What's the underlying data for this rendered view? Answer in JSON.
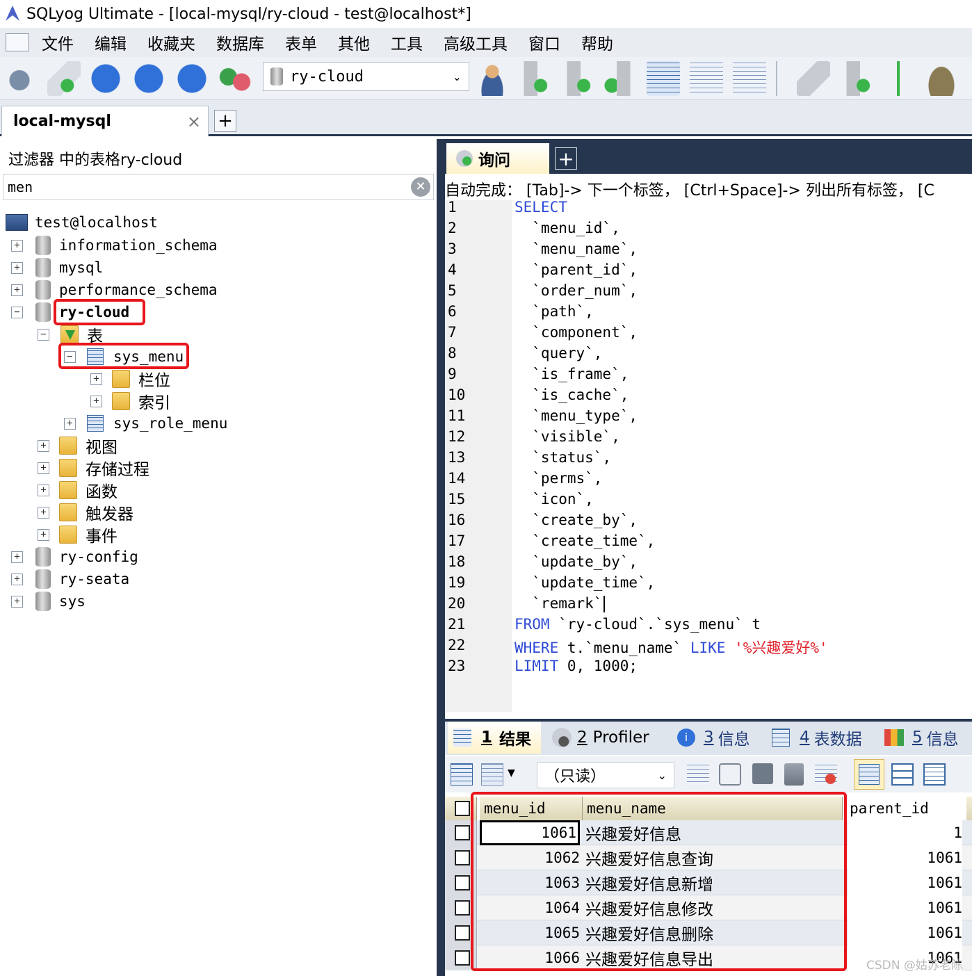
{
  "window": {
    "title": "SQLyog Ultimate - [local-mysql/ry-cloud - test@localhost*]"
  },
  "menu": [
    {
      "label": "文件",
      "underline": "件"
    },
    {
      "label": "编辑"
    },
    {
      "label": "收藏夹"
    },
    {
      "label": "数据库"
    },
    {
      "label": "表单"
    },
    {
      "label": "其他"
    },
    {
      "label": "工具"
    },
    {
      "label": "高级工具"
    },
    {
      "label": "窗口"
    },
    {
      "label": "帮助"
    }
  ],
  "toolbar": {
    "database_selector": "ry-cloud"
  },
  "connection_tab": {
    "label": "local-mysql",
    "close": "×",
    "add": "+"
  },
  "object_browser": {
    "filter_label": "过滤器 中的表格ry-cloud",
    "filter_value": "men",
    "host": "test@localhost",
    "databases": [
      "information_schema",
      "mysql",
      "performance_schema",
      "ry-cloud"
    ],
    "tables_folder": "表",
    "table_selected": "sys_menu",
    "columns_folder": "栏位",
    "indexes_folder": "索引",
    "table_other": "sys_role_menu",
    "folders": [
      "视图",
      "存储过程",
      "函数",
      "触发器",
      "事件"
    ],
    "other_databases": [
      "ry-config",
      "ry-seata",
      "sys"
    ],
    "expand": "+",
    "collapse": "−"
  },
  "query_tab": {
    "label": "询问",
    "add": "+"
  },
  "autocomplete_hint": "自动完成： [Tab]-> 下一个标签， [Ctrl+Space]-> 列出所有标签， [C",
  "editor": {
    "line_numbers": [
      "1",
      "2",
      "3",
      "4",
      "5",
      "6",
      "7",
      "8",
      "9",
      "10",
      "11",
      "12",
      "13",
      "14",
      "15",
      "16",
      "17",
      "18",
      "19",
      "20",
      "21",
      "22",
      "23"
    ],
    "lines": [
      {
        "kw": "SELECT",
        "text": "",
        "str": ""
      },
      {
        "kw": "",
        "text": "  `menu_id`,",
        "str": ""
      },
      {
        "kw": "",
        "text": "  `menu_name`,",
        "str": ""
      },
      {
        "kw": "",
        "text": "  `parent_id`,",
        "str": ""
      },
      {
        "kw": "",
        "text": "  `order_num`,",
        "str": ""
      },
      {
        "kw": "",
        "text": "  `path`,",
        "str": ""
      },
      {
        "kw": "",
        "text": "  `component`,",
        "str": ""
      },
      {
        "kw": "",
        "text": "  `query`,",
        "str": ""
      },
      {
        "kw": "",
        "text": "  `is_frame`,",
        "str": ""
      },
      {
        "kw": "",
        "text": "  `is_cache`,",
        "str": ""
      },
      {
        "kw": "",
        "text": "  `menu_type`,",
        "str": ""
      },
      {
        "kw": "",
        "text": "  `visible`,",
        "str": ""
      },
      {
        "kw": "",
        "text": "  `status`,",
        "str": ""
      },
      {
        "kw": "",
        "text": "  `perms`,",
        "str": ""
      },
      {
        "kw": "",
        "text": "  `icon`,",
        "str": ""
      },
      {
        "kw": "",
        "text": "  `create_by`,",
        "str": ""
      },
      {
        "kw": "",
        "text": "  `create_time`,",
        "str": ""
      },
      {
        "kw": "",
        "text": "  `update_by`,",
        "str": ""
      },
      {
        "kw": "",
        "text": "  `update_time`,",
        "str": ""
      },
      {
        "kw": "",
        "text": "  `remark`",
        "str": ""
      },
      {
        "kw": "FROM",
        "text": " `ry-cloud`.`sys_menu` t",
        "str": ""
      },
      {
        "kw": "WHERE",
        "text": " t.`menu_name` ",
        "kw2": "LIKE",
        "str": "'%兴趣爱好%'"
      },
      {
        "kw": "LIMIT",
        "text": " 0, 1000;",
        "str": ""
      }
    ]
  },
  "result_tabs": [
    {
      "num": "1",
      "label": "结果",
      "active": true
    },
    {
      "num": "2",
      "label": "Profiler"
    },
    {
      "num": "3",
      "label": "信息"
    },
    {
      "num": "4",
      "label": "表数据"
    },
    {
      "num": "5",
      "label": "信息"
    }
  ],
  "result_toolbar": {
    "mode": "（只读）"
  },
  "grid": {
    "columns": [
      "menu_id",
      "menu_name",
      "parent_id"
    ],
    "rows": [
      [
        "1061",
        "兴趣爱好信息",
        "1"
      ],
      [
        "1062",
        "兴趣爱好信息查询",
        "1061"
      ],
      [
        "1063",
        "兴趣爱好信息新增",
        "1061"
      ],
      [
        "1064",
        "兴趣爱好信息修改",
        "1061"
      ],
      [
        "1065",
        "兴趣爱好信息删除",
        "1061"
      ],
      [
        "1066",
        "兴趣爱好信息导出",
        "1061"
      ]
    ]
  },
  "watermark": "CSDN @姑苏老陈"
}
